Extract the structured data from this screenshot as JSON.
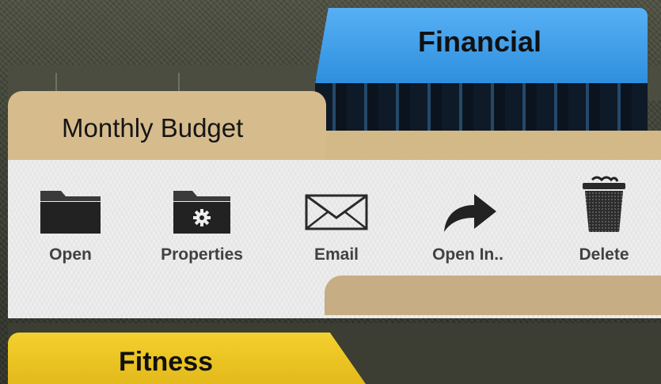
{
  "categories": {
    "top": "Financial",
    "bottom": "Fitness"
  },
  "document": {
    "title": "Monthly Budget"
  },
  "actions": [
    {
      "label": "Open",
      "icon": "folder-icon"
    },
    {
      "label": "Properties",
      "icon": "folder-gear-icon"
    },
    {
      "label": "Email",
      "icon": "envelope-icon"
    },
    {
      "label": "Open In..",
      "icon": "share-arrow-icon"
    },
    {
      "label": "Delete",
      "icon": "trash-icon"
    }
  ],
  "colors": {
    "financial_tab": "#3a9ae6",
    "fitness_tab": "#efc825",
    "folder_tan": "#d6bb8c",
    "card_bg": "#eeeeee",
    "icon_dark": "#1f1f1f"
  }
}
